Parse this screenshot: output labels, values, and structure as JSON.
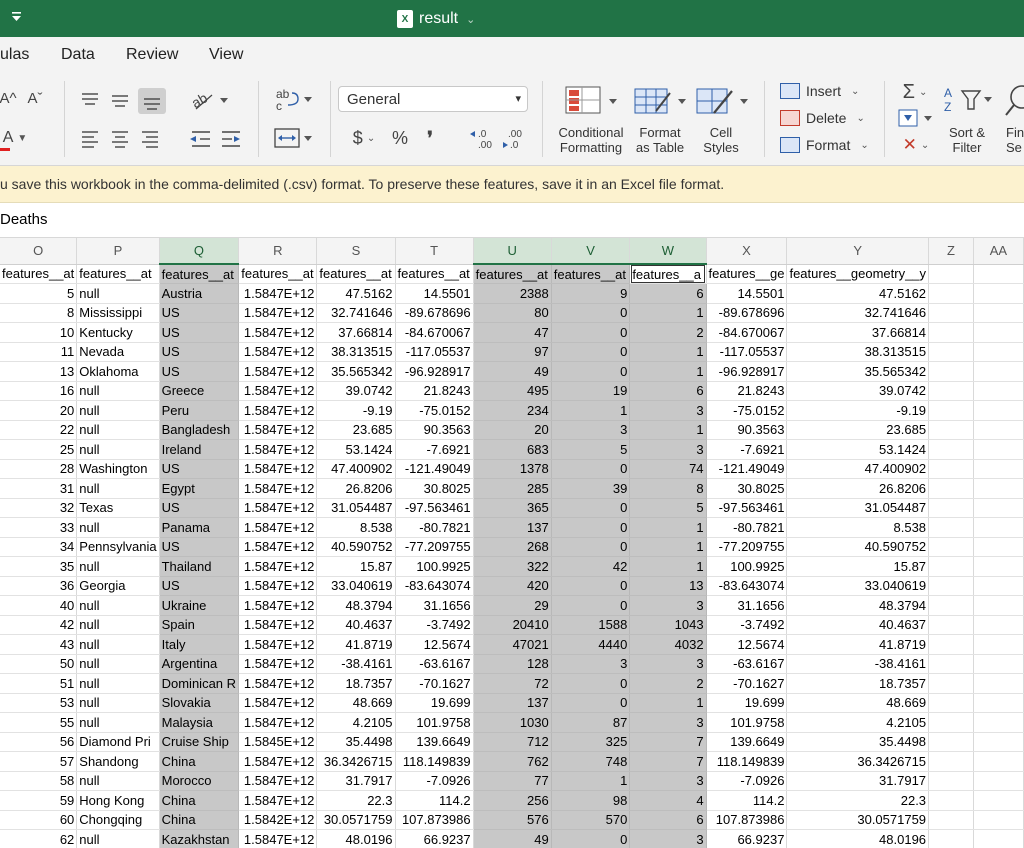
{
  "titlebar": {
    "doc_title": "result",
    "file_icon": "excel-file-icon",
    "qa_icon": "quick-access-dropdown-icon"
  },
  "menu": [
    "ulas",
    "Data",
    "Review",
    "View"
  ],
  "ribbon": {
    "number_format": "General",
    "conditional_formatting": [
      "Conditional",
      "Formatting"
    ],
    "format_as_table": [
      "Format",
      "as Table"
    ],
    "cell_styles": [
      "Cell",
      "Styles"
    ],
    "insert": "Insert",
    "delete": "Delete",
    "format": "Format",
    "sort_filter": [
      "Sort &",
      "Filter"
    ],
    "find": [
      "Fin",
      "Se"
    ],
    "currency_symbol": "$",
    "percent_symbol": "%",
    "comma_symbol": "❜",
    "increase_decimal": "←.0\n.00",
    "decrease_decimal": ".00\n→.0",
    "font_grow": "A^",
    "font_shrink": "Aˇ",
    "font_color": "A",
    "autosum": "Σ",
    "clear": "✕"
  },
  "warning": "u save this workbook in the comma-delimited (.csv) format. To preserve these features, save it in an Excel file format.",
  "formula_bar": "Deaths",
  "columns": [
    "O",
    "P",
    "Q",
    "R",
    "S",
    "T",
    "U",
    "V",
    "W",
    "X",
    "Y",
    "Z",
    "AA"
  ],
  "selected_columns": [
    "Q",
    "U",
    "V",
    "W"
  ],
  "header_row": [
    "features__at",
    "features__at",
    "features__at",
    "features__at",
    "features__at",
    "features__at",
    "features__at",
    "features__at",
    "features__a",
    "features__ge",
    "features__geometry__y",
    "",
    ""
  ],
  "rows": [
    [
      "5",
      "null",
      "Austria",
      "1.5847E+12",
      "47.5162",
      "14.5501",
      "2388",
      "9",
      "6",
      "14.5501",
      "47.5162"
    ],
    [
      "8",
      "Mississippi",
      "US",
      "1.5847E+12",
      "32.741646",
      "-89.678696",
      "80",
      "0",
      "1",
      "-89.678696",
      "32.741646"
    ],
    [
      "10",
      "Kentucky",
      "US",
      "1.5847E+12",
      "37.66814",
      "-84.670067",
      "47",
      "0",
      "2",
      "-84.670067",
      "37.66814"
    ],
    [
      "11",
      "Nevada",
      "US",
      "1.5847E+12",
      "38.313515",
      "-117.05537",
      "97",
      "0",
      "1",
      "-117.05537",
      "38.313515"
    ],
    [
      "13",
      "Oklahoma",
      "US",
      "1.5847E+12",
      "35.565342",
      "-96.928917",
      "49",
      "0",
      "1",
      "-96.928917",
      "35.565342"
    ],
    [
      "16",
      "null",
      "Greece",
      "1.5847E+12",
      "39.0742",
      "21.8243",
      "495",
      "19",
      "6",
      "21.8243",
      "39.0742"
    ],
    [
      "20",
      "null",
      "Peru",
      "1.5847E+12",
      "-9.19",
      "-75.0152",
      "234",
      "1",
      "3",
      "-75.0152",
      "-9.19"
    ],
    [
      "22",
      "null",
      "Bangladesh",
      "1.5847E+12",
      "23.685",
      "90.3563",
      "20",
      "3",
      "1",
      "90.3563",
      "23.685"
    ],
    [
      "25",
      "null",
      "Ireland",
      "1.5847E+12",
      "53.1424",
      "-7.6921",
      "683",
      "5",
      "3",
      "-7.6921",
      "53.1424"
    ],
    [
      "28",
      "Washington",
      "US",
      "1.5847E+12",
      "47.400902",
      "-121.49049",
      "1378",
      "0",
      "74",
      "-121.49049",
      "47.400902"
    ],
    [
      "31",
      "null",
      "Egypt",
      "1.5847E+12",
      "26.8206",
      "30.8025",
      "285",
      "39",
      "8",
      "30.8025",
      "26.8206"
    ],
    [
      "32",
      "Texas",
      "US",
      "1.5847E+12",
      "31.054487",
      "-97.563461",
      "365",
      "0",
      "5",
      "-97.563461",
      "31.054487"
    ],
    [
      "33",
      "null",
      "Panama",
      "1.5847E+12",
      "8.538",
      "-80.7821",
      "137",
      "0",
      "1",
      "-80.7821",
      "8.538"
    ],
    [
      "34",
      "Pennsylvania",
      "US",
      "1.5847E+12",
      "40.590752",
      "-77.209755",
      "268",
      "0",
      "1",
      "-77.209755",
      "40.590752"
    ],
    [
      "35",
      "null",
      "Thailand",
      "1.5847E+12",
      "15.87",
      "100.9925",
      "322",
      "42",
      "1",
      "100.9925",
      "15.87"
    ],
    [
      "36",
      "Georgia",
      "US",
      "1.5847E+12",
      "33.040619",
      "-83.643074",
      "420",
      "0",
      "13",
      "-83.643074",
      "33.040619"
    ],
    [
      "40",
      "null",
      "Ukraine",
      "1.5847E+12",
      "48.3794",
      "31.1656",
      "29",
      "0",
      "3",
      "31.1656",
      "48.3794"
    ],
    [
      "42",
      "null",
      "Spain",
      "1.5847E+12",
      "40.4637",
      "-3.7492",
      "20410",
      "1588",
      "1043",
      "-3.7492",
      "40.4637"
    ],
    [
      "43",
      "null",
      "Italy",
      "1.5847E+12",
      "41.8719",
      "12.5674",
      "47021",
      "4440",
      "4032",
      "12.5674",
      "41.8719"
    ],
    [
      "50",
      "null",
      "Argentina",
      "1.5847E+12",
      "-38.4161",
      "-63.6167",
      "128",
      "3",
      "3",
      "-63.6167",
      "-38.4161"
    ],
    [
      "51",
      "null",
      "Dominican R",
      "1.5847E+12",
      "18.7357",
      "-70.1627",
      "72",
      "0",
      "2",
      "-70.1627",
      "18.7357"
    ],
    [
      "53",
      "null",
      "Slovakia",
      "1.5847E+12",
      "48.669",
      "19.699",
      "137",
      "0",
      "1",
      "19.699",
      "48.669"
    ],
    [
      "55",
      "null",
      "Malaysia",
      "1.5847E+12",
      "4.2105",
      "101.9758",
      "1030",
      "87",
      "3",
      "101.9758",
      "4.2105"
    ],
    [
      "56",
      "Diamond Pri",
      "Cruise Ship",
      "1.5845E+12",
      "35.4498",
      "139.6649",
      "712",
      "325",
      "7",
      "139.6649",
      "35.4498"
    ],
    [
      "57",
      "Shandong",
      "China",
      "1.5847E+12",
      "36.3426715",
      "118.149839",
      "762",
      "748",
      "7",
      "118.149839",
      "36.3426715"
    ],
    [
      "58",
      "null",
      "Morocco",
      "1.5847E+12",
      "31.7917",
      "-7.0926",
      "77",
      "1",
      "3",
      "-7.0926",
      "31.7917"
    ],
    [
      "59",
      "Hong Kong",
      "China",
      "1.5847E+12",
      "22.3",
      "114.2",
      "256",
      "98",
      "4",
      "114.2",
      "22.3"
    ],
    [
      "60",
      "Chongqing",
      "China",
      "1.5842E+12",
      "30.0571759",
      "107.873986",
      "576",
      "570",
      "6",
      "107.873986",
      "30.0571759"
    ],
    [
      "62",
      "null",
      "Kazakhstan",
      "1.5847E+12",
      "48.0196",
      "66.9237",
      "49",
      "0",
      "3",
      "66.9237",
      "48.0196"
    ]
  ]
}
